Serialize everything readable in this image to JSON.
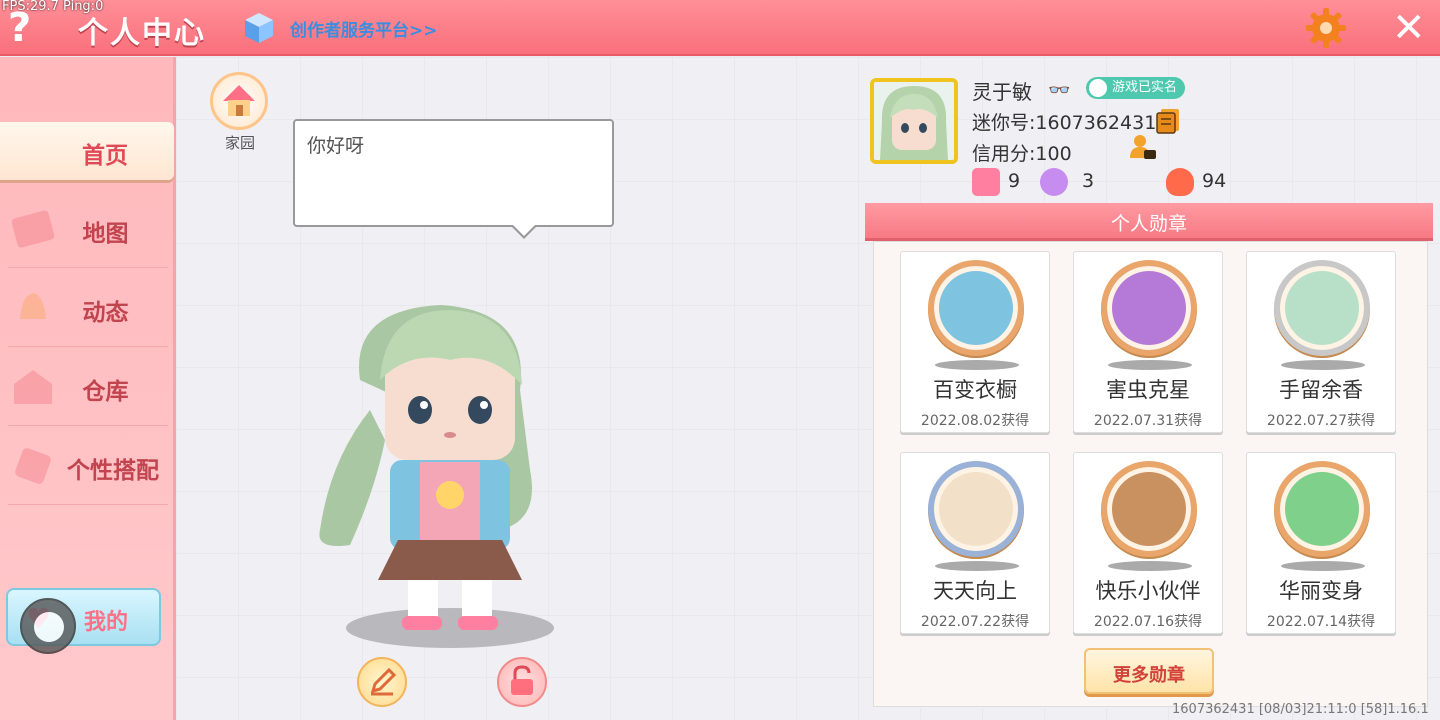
{
  "debug": {
    "text": "FPS:29.7  Ping:0"
  },
  "header": {
    "help": "?",
    "title": "个人中心",
    "creator_link": "创作者服务平台>>",
    "close": "✕",
    "accent": "#f9707b"
  },
  "sidebar": {
    "items": [
      {
        "label": "首页",
        "icon": "home-card-icon"
      },
      {
        "label": "地图",
        "icon": "map-icon"
      },
      {
        "label": "动态",
        "icon": "bell-icon"
      },
      {
        "label": "仓库",
        "icon": "warehouse-icon"
      },
      {
        "label": "个性搭配",
        "icon": "outfit-icon"
      }
    ],
    "mine": {
      "label": "我的",
      "icon": "heart-icon"
    }
  },
  "main": {
    "home": {
      "label": "家园"
    },
    "bubble": {
      "text": "你好呀"
    }
  },
  "profile": {
    "name": "灵于敏",
    "verified": "游戏已实名",
    "mini_id": "迷你号:1607362431",
    "credit": "信用分:100",
    "stats": [
      {
        "icon": "add-friend-icon",
        "value": "9",
        "color": "#ff7fa0"
      },
      {
        "icon": "fans-icon",
        "value": "3",
        "color": "#c78cf0"
      },
      {
        "icon": "popularity-icon",
        "value": "94",
        "color": "#ff6a4a"
      }
    ]
  },
  "medals": {
    "header": "个人勋章",
    "items": [
      {
        "name": "百变衣橱",
        "date": "2022.08.02获得",
        "color": "#e9a56a"
      },
      {
        "name": "害虫克星",
        "date": "2022.07.31获得",
        "color": "#e9a56a"
      },
      {
        "name": "手留余香",
        "date": "2022.07.27获得",
        "color": "#c8c8c8"
      },
      {
        "name": "天天向上",
        "date": "2022.07.22获得",
        "color": "#9ab2d8"
      },
      {
        "name": "快乐小伙伴",
        "date": "2022.07.16获得",
        "color": "#e9a56a"
      },
      {
        "name": "华丽变身",
        "date": "2022.07.14获得",
        "color": "#e9a56a"
      }
    ],
    "more": "更多勋章"
  },
  "footer": {
    "text": "1607362431   [08/03]21:11:0   [58]1.16.1"
  }
}
